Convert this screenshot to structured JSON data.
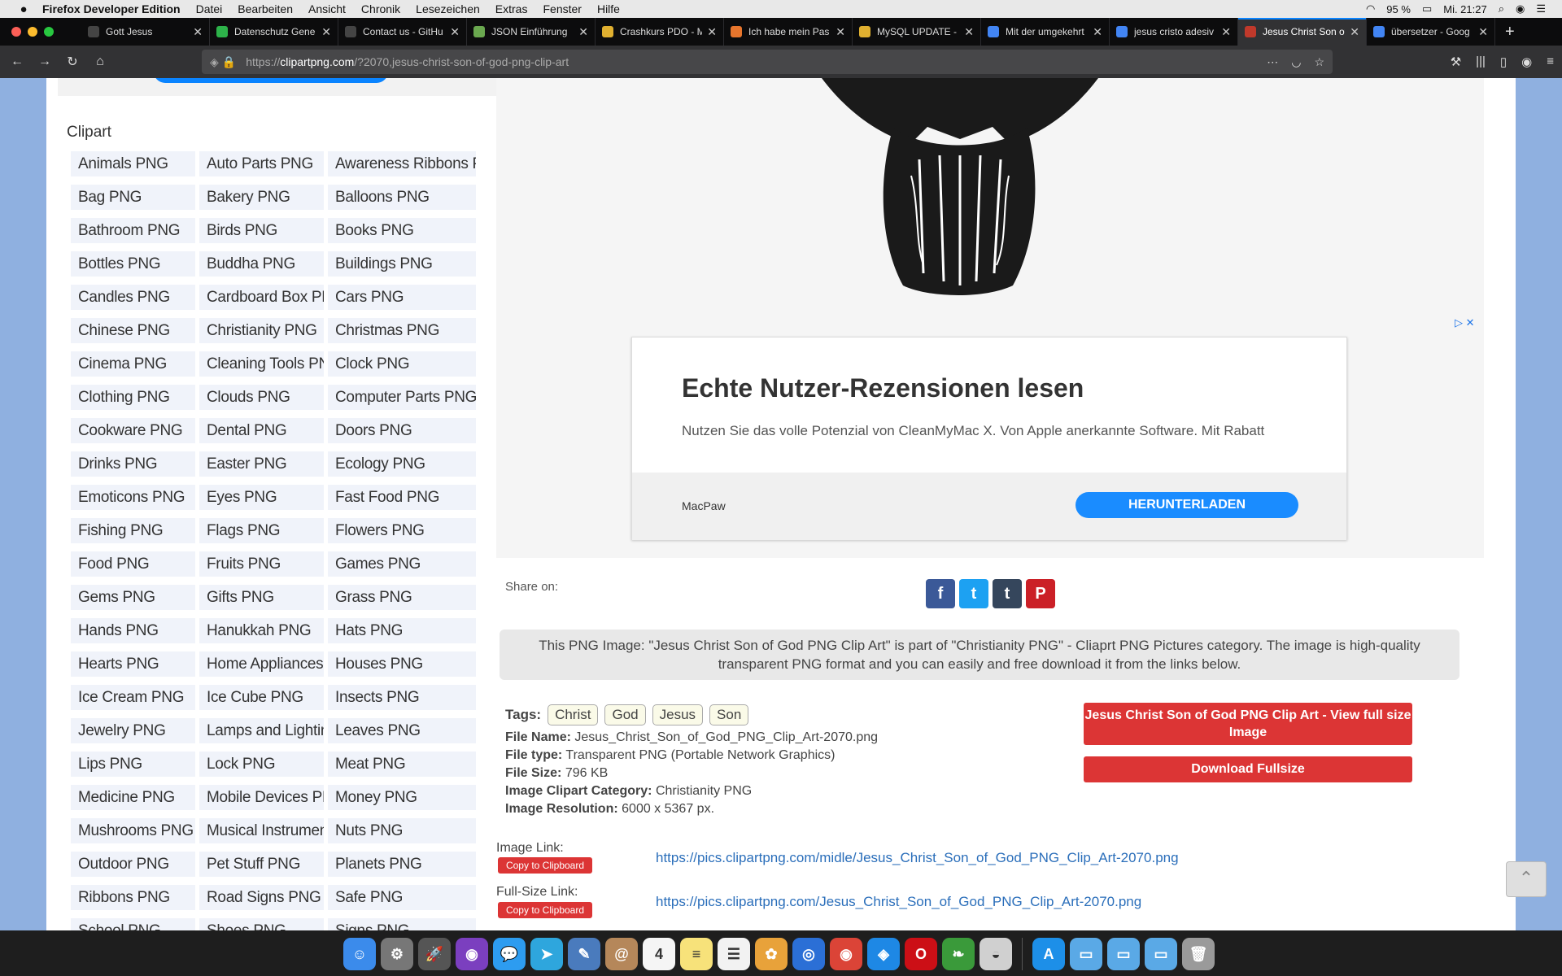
{
  "menubar": {
    "app": "Firefox Developer Edition",
    "items": [
      "Datei",
      "Bearbeiten",
      "Ansicht",
      "Chronik",
      "Lesezeichen",
      "Extras",
      "Fenster",
      "Hilfe"
    ],
    "battery": "95 %",
    "clock": "Mi. 21:27"
  },
  "tabs": [
    {
      "title": "Gott Jesus",
      "color": "#444444"
    },
    {
      "title": "Datenschutz Gene",
      "color": "#2db34a"
    },
    {
      "title": "Contact us - GitHu",
      "color": "#444444"
    },
    {
      "title": "JSON Einführung",
      "color": "#6aa84f"
    },
    {
      "title": "Crashkurs PDO - M",
      "color": "#e0b030"
    },
    {
      "title": "Ich habe mein Pas",
      "color": "#e8762d"
    },
    {
      "title": "MySQL UPDATE -",
      "color": "#e0b030"
    },
    {
      "title": "Mit der umgekehrt",
      "color": "#4285f4"
    },
    {
      "title": "jesus cristo adesiv",
      "color": "#4285f4"
    },
    {
      "title": "Jesus Christ Son of",
      "color": "#c0392b",
      "active": true
    },
    {
      "title": "übersetzer - Goog",
      "color": "#4285f4"
    }
  ],
  "url": {
    "prefix": "https://",
    "domain": "clipartpng.com",
    "path": "/?2070,jesus-christ-son-of-god-png-clip-art"
  },
  "sidebar": {
    "title": "Clipart",
    "items": [
      "Animals PNG",
      "Auto Parts PNG",
      "Awareness Ribbons PNG",
      "Bag PNG",
      "Bakery PNG",
      "Balloons PNG",
      "Bathroom PNG",
      "Birds PNG",
      "Books PNG",
      "Bottles PNG",
      "Buddha PNG",
      "Buildings PNG",
      "Candles PNG",
      "Cardboard Box PNG",
      "Cars PNG",
      "Chinese PNG",
      "Christianity PNG",
      "Christmas PNG",
      "Cinema PNG",
      "Cleaning Tools PNG",
      "Clock PNG",
      "Clothing PNG",
      "Clouds PNG",
      "Computer Parts PNG",
      "Cookware PNG",
      "Dental PNG",
      "Doors PNG",
      "Drinks PNG",
      "Easter PNG",
      "Ecology PNG",
      "Emoticons PNG",
      "Eyes PNG",
      "Fast Food PNG",
      "Fishing PNG",
      "Flags PNG",
      "Flowers PNG",
      "Food PNG",
      "Fruits PNG",
      "Games PNG",
      "Gems PNG",
      "Gifts PNG",
      "Grass PNG",
      "Hands PNG",
      "Hanukkah PNG",
      "Hats PNG",
      "Hearts PNG",
      "Home Appliances PNG",
      "Houses PNG",
      "Ice Cream PNG",
      "Ice Cube PNG",
      "Insects PNG",
      "Jewelry PNG",
      "Lamps and Lighting PNG",
      "Leaves PNG",
      "Lips PNG",
      "Lock PNG",
      "Meat PNG",
      "Medicine PNG",
      "Mobile Devices PNG",
      "Money PNG",
      "Mushrooms PNG",
      "Musical Instruments PNG",
      "Nuts PNG",
      "Outdoor PNG",
      "Pet Stuff PNG",
      "Planets PNG",
      "Ribbons PNG",
      "Road Signs PNG",
      "Safe PNG",
      "School PNG",
      "Shoes PNG",
      "Signs PNG"
    ]
  },
  "ad": {
    "headline": "Echte Nutzer-Rezensionen lesen",
    "text": "Nutzen Sie das volle Potenzial von CleanMyMac X. Von Apple anerkannte Software. Mit Rabatt",
    "brand": "MacPaw",
    "button": "HERUNTERLADEN"
  },
  "share": {
    "label": "Share on:",
    "icons": [
      {
        "name": "facebook-icon",
        "glyph": "f",
        "color": "#3b5998"
      },
      {
        "name": "twitter-icon",
        "glyph": "t",
        "color": "#1da1f2"
      },
      {
        "name": "tumblr-icon",
        "glyph": "t",
        "color": "#35465c"
      },
      {
        "name": "pinterest-icon",
        "glyph": "P",
        "color": "#cb2027"
      }
    ]
  },
  "description": "This PNG Image: \"Jesus Christ Son of God PNG Clip Art\" is part of \"Christianity PNG\" - Cliaprt PNG Pictures category. The image is high-quality transparent PNG format and you can easily and free download it from the links below.",
  "tags": {
    "label": "Tags:",
    "items": [
      "Christ",
      "God",
      "Jesus",
      "Son"
    ]
  },
  "meta": [
    {
      "label": "File Name:",
      "value": "Jesus_Christ_Son_of_God_PNG_Clip_Art-2070.png"
    },
    {
      "label": "File type:",
      "value": "Transparent PNG (Portable Network Graphics)"
    },
    {
      "label": "File Size:",
      "value": "796 KB"
    },
    {
      "label": "Image Clipart Category:",
      "value": "Christianity PNG"
    },
    {
      "label": "Image Resolution:",
      "value": "6000 x 5367 px."
    }
  ],
  "buttons": {
    "view_full": "Jesus Christ Son of God PNG Clip Art - View full size Image",
    "download": "Download Fullsize"
  },
  "links": {
    "image_label": "Image Link:",
    "image_url": "https://pics.clipartpng.com/midle/Jesus_Christ_Son_of_God_PNG_Clip_Art-2070.png",
    "full_label": "Full-Size Link:",
    "full_url": "https://pics.clipartpng.com/Jesus_Christ_Son_of_God_PNG_Clip_Art-2070.png",
    "copy_label": "Copy to Clipboard"
  },
  "scrolltop_glyph": "⌃",
  "dock": [
    {
      "name": "finder-icon",
      "color": "#3b8beb",
      "glyph": "☺"
    },
    {
      "name": "system-preferences-icon",
      "color": "#777777",
      "glyph": "⚙"
    },
    {
      "name": "launchpad-icon",
      "color": "#555555",
      "glyph": "🚀"
    },
    {
      "name": "siri-icon",
      "color": "#7b3fbf",
      "glyph": "◉"
    },
    {
      "name": "messages-icon",
      "color": "#2d9cf0",
      "glyph": "💬"
    },
    {
      "name": "telegram-icon",
      "color": "#2ea6dd",
      "glyph": "➤"
    },
    {
      "name": "preview-icon",
      "color": "#4a7bbd",
      "glyph": "✎"
    },
    {
      "name": "contacts-icon",
      "color": "#b5875a",
      "glyph": "@"
    },
    {
      "name": "calendar-icon",
      "color": "#f5f5f5",
      "glyph": "4"
    },
    {
      "name": "notes-icon",
      "color": "#f7e27a",
      "glyph": "≡"
    },
    {
      "name": "reminders-icon",
      "color": "#f2f2f2",
      "glyph": "☰"
    },
    {
      "name": "photos-icon",
      "color": "#e8a23a",
      "glyph": "✿"
    },
    {
      "name": "firefox-dev-icon",
      "color": "#2b6fd6",
      "glyph": "◎"
    },
    {
      "name": "chrome-icon",
      "color": "#db4437",
      "glyph": "◉"
    },
    {
      "name": "safari-icon",
      "color": "#1e88e5",
      "glyph": "◈"
    },
    {
      "name": "opera-icon",
      "color": "#cc0f16",
      "glyph": "O"
    },
    {
      "name": "leaf-app-icon",
      "color": "#3a9a3a",
      "glyph": "❧"
    },
    {
      "name": "elephant-app-icon",
      "color": "#d0d0d0",
      "glyph": "◒"
    },
    {
      "name": "app-store-icon",
      "color": "#1d8fe8",
      "glyph": "A"
    },
    {
      "name": "folder-icon",
      "color": "#5aa9e6",
      "glyph": "▭"
    },
    {
      "name": "documents-folder-icon",
      "color": "#5aa9e6",
      "glyph": "▭"
    },
    {
      "name": "downloads-folder-icon",
      "color": "#5aa9e6",
      "glyph": "▭"
    },
    {
      "name": "trash-icon",
      "color": "#9a9a9a",
      "glyph": "🗑"
    }
  ]
}
